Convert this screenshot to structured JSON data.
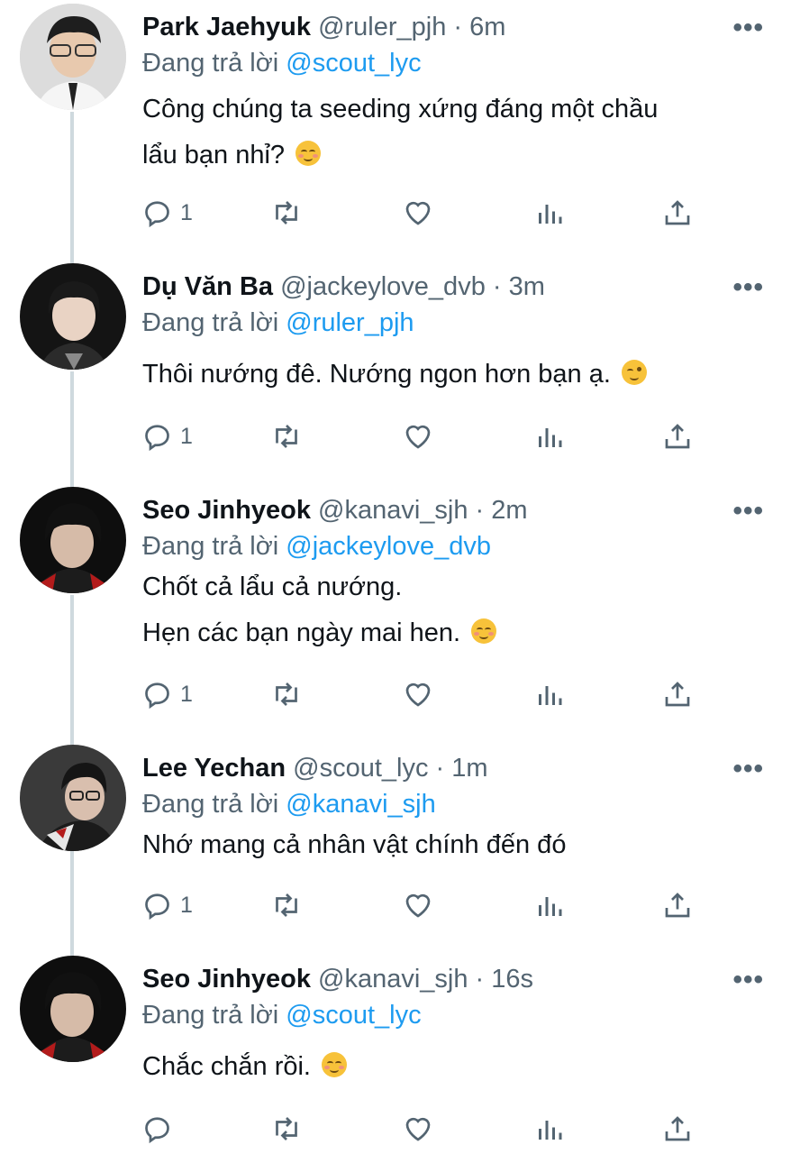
{
  "tweets": [
    {
      "name": "Park Jaehyuk",
      "handle": "@ruler_pjh",
      "time": "6m",
      "reply_prefix": "Đang trả lời",
      "reply_to": "@scout_lyc",
      "lines": [
        "Công chúng ta seeding xứng đáng một chầu",
        "lẩu bạn nhỉ?"
      ],
      "emoji": "relieved-face",
      "reply_count": "1"
    },
    {
      "name": "Dụ Văn Ba",
      "handle": "@jackeylove_dvb",
      "time": "3m",
      "reply_prefix": "Đang trả lời",
      "reply_to": "@ruler_pjh",
      "lines": [
        "Thôi nướng đê. Nướng ngon hơn bạn ạ."
      ],
      "emoji": "winking-face",
      "reply_count": "1"
    },
    {
      "name": "Seo Jinhyeok",
      "handle": "@kanavi_sjh",
      "time": "2m",
      "reply_prefix": "Đang trả lời",
      "reply_to": "@jackeylove_dvb",
      "lines": [
        "Chốt cả lẩu cả nướng.",
        "Hẹn các bạn ngày mai hen."
      ],
      "emoji": "smiling-face",
      "reply_count": "1"
    },
    {
      "name": "Lee Yechan",
      "handle": "@scout_lyc",
      "time": "1m",
      "reply_prefix": "Đang trả lời",
      "reply_to": "@kanavi_sjh",
      "lines": [
        "Nhớ mang cả nhân vật chính đến đó"
      ],
      "emoji": "",
      "reply_count": "1"
    },
    {
      "name": "Seo Jinhyeok",
      "handle": "@kanavi_sjh",
      "time": "16s",
      "reply_prefix": "Đang trả lời",
      "reply_to": "@scout_lyc",
      "lines": [
        "Chắc chắn rồi."
      ],
      "emoji": "smiling-face",
      "reply_count": ""
    }
  ],
  "separator": " · ",
  "more_icon": "more-dots-icon",
  "icons": [
    "reply-icon",
    "retweet-icon",
    "like-icon",
    "analytics-icon",
    "share-icon"
  ],
  "colors": {
    "link": "#1d9bf0",
    "muted": "#536471",
    "thread_line": "#cfd9de"
  }
}
